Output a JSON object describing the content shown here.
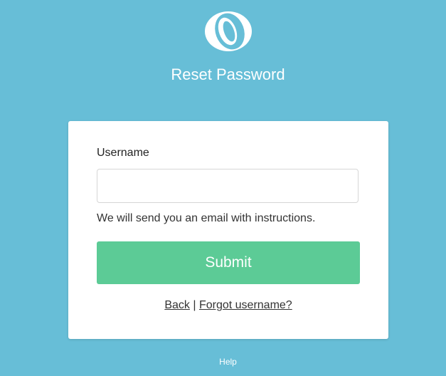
{
  "header": {
    "title": "Reset Password"
  },
  "form": {
    "username_label": "Username",
    "username_value": "",
    "username_placeholder": "",
    "instructions": "We will send you an email with instructions.",
    "submit_label": "Submit"
  },
  "links": {
    "back": "Back",
    "separator": "|",
    "forgot_username": "Forgot username?"
  },
  "footer": {
    "help": "Help"
  },
  "colors": {
    "background": "#67bed7",
    "button": "#5ccb96",
    "card": "#ffffff"
  },
  "icons": {
    "logo": "ring-logo-icon"
  }
}
